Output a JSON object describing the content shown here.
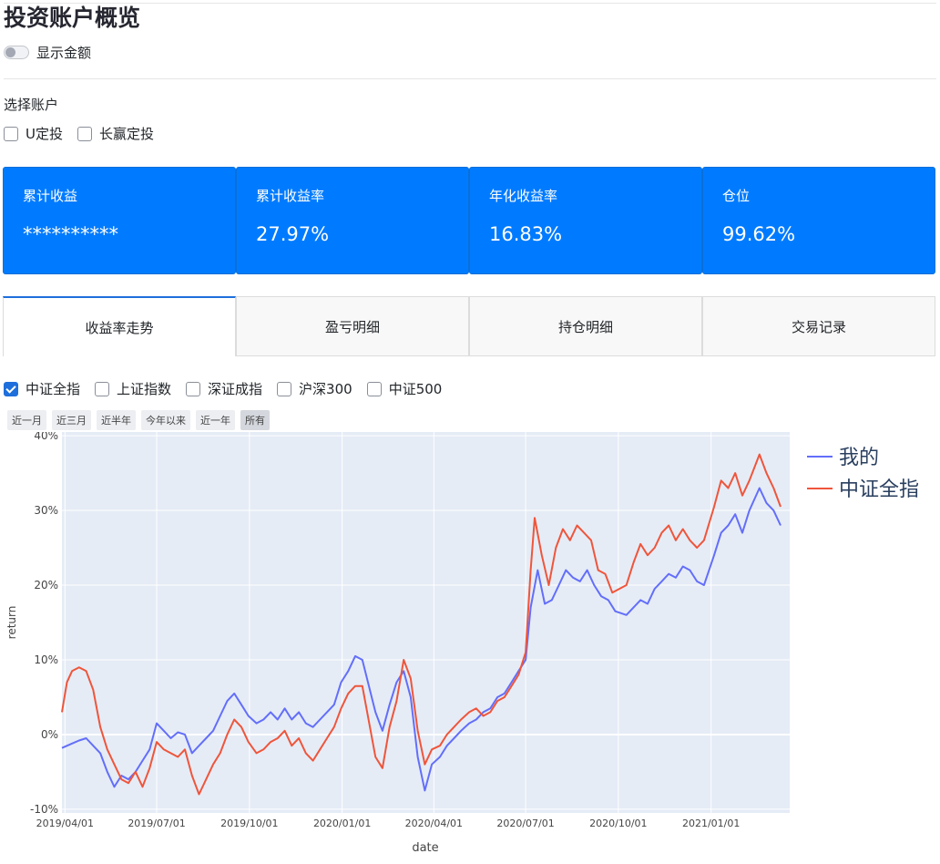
{
  "title": "投资账户概览",
  "show_amount_label": "显示金额",
  "select_account_label": "选择账户",
  "accounts": [
    {
      "label": "U定投",
      "checked": false
    },
    {
      "label": "长赢定投",
      "checked": false
    }
  ],
  "metrics": [
    {
      "label": "累计收益",
      "value": "**********"
    },
    {
      "label": "累计收益率",
      "value": "27.97%"
    },
    {
      "label": "年化收益率",
      "value": "16.83%"
    },
    {
      "label": "仓位",
      "value": "99.62%"
    }
  ],
  "tabs": [
    "收益率走势",
    "盈亏明细",
    "持仓明细",
    "交易记录"
  ],
  "active_tab": 0,
  "index_options": [
    {
      "label": "中证全指",
      "checked": true
    },
    {
      "label": "上证指数",
      "checked": false
    },
    {
      "label": "深证成指",
      "checked": false
    },
    {
      "label": "沪深300",
      "checked": false
    },
    {
      "label": "中证500",
      "checked": false
    }
  ],
  "range_buttons": [
    "近一月",
    "近三月",
    "近半年",
    "今年以来",
    "近一年",
    "所有"
  ],
  "active_range": 5,
  "colors": {
    "accent": "#007bff",
    "series_mine": "#636efa",
    "series_index": "#ef553b",
    "plot_bg": "#e5ecf6"
  },
  "chart_data": {
    "type": "line",
    "xlabel": "date",
    "ylabel": "return",
    "x_ticks": [
      "2019/04/01",
      "2019/07/01",
      "2019/10/01",
      "2020/01/01",
      "2020/04/01",
      "2020/07/01",
      "2020/10/01",
      "2021/01/01"
    ],
    "y_ticks": [
      "40%",
      "30%",
      "20%",
      "10%",
      "0%",
      "-10%"
    ],
    "xlim": [
      "2019-03-29",
      "2021-03-20"
    ],
    "ylim": [
      -10.5,
      40.5
    ],
    "grid": true,
    "legend": "top-right",
    "series": [
      {
        "name": "我的",
        "points": [
          [
            "2019-03-29",
            -1.8
          ],
          [
            "2019-04-08",
            -1.2
          ],
          [
            "2019-04-15",
            -0.8
          ],
          [
            "2019-04-22",
            -0.5
          ],
          [
            "2019-04-29",
            -1.5
          ],
          [
            "2019-05-06",
            -2.5
          ],
          [
            "2019-05-13",
            -5.0
          ],
          [
            "2019-05-20",
            -7.0
          ],
          [
            "2019-05-27",
            -5.5
          ],
          [
            "2019-06-03",
            -6.0
          ],
          [
            "2019-06-10",
            -5.0
          ],
          [
            "2019-06-17",
            -3.5
          ],
          [
            "2019-06-24",
            -2.0
          ],
          [
            "2019-07-01",
            1.5
          ],
          [
            "2019-07-08",
            0.5
          ],
          [
            "2019-07-15",
            -0.5
          ],
          [
            "2019-07-22",
            0.3
          ],
          [
            "2019-07-29",
            0.0
          ],
          [
            "2019-08-05",
            -2.5
          ],
          [
            "2019-08-12",
            -1.5
          ],
          [
            "2019-08-19",
            -0.5
          ],
          [
            "2019-08-26",
            0.5
          ],
          [
            "2019-09-02",
            2.5
          ],
          [
            "2019-09-09",
            4.5
          ],
          [
            "2019-09-16",
            5.5
          ],
          [
            "2019-09-23",
            4.0
          ],
          [
            "2019-09-30",
            2.5
          ],
          [
            "2019-10-08",
            1.5
          ],
          [
            "2019-10-15",
            2.0
          ],
          [
            "2019-10-22",
            3.0
          ],
          [
            "2019-10-29",
            2.0
          ],
          [
            "2019-11-05",
            3.5
          ],
          [
            "2019-11-12",
            2.0
          ],
          [
            "2019-11-19",
            3.0
          ],
          [
            "2019-11-26",
            1.5
          ],
          [
            "2019-12-03",
            1.0
          ],
          [
            "2019-12-10",
            2.0
          ],
          [
            "2019-12-17",
            3.0
          ],
          [
            "2019-12-24",
            4.0
          ],
          [
            "2019-12-31",
            7.0
          ],
          [
            "2020-01-07",
            8.5
          ],
          [
            "2020-01-14",
            10.5
          ],
          [
            "2020-01-21",
            10.0
          ],
          [
            "2020-02-03",
            3.0
          ],
          [
            "2020-02-10",
            0.5
          ],
          [
            "2020-02-17",
            4.0
          ],
          [
            "2020-02-24",
            7.0
          ],
          [
            "2020-03-02",
            8.5
          ],
          [
            "2020-03-09",
            5.0
          ],
          [
            "2020-03-16",
            -3.0
          ],
          [
            "2020-03-23",
            -7.5
          ],
          [
            "2020-03-30",
            -4.0
          ],
          [
            "2020-04-07",
            -3.0
          ],
          [
            "2020-04-14",
            -1.5
          ],
          [
            "2020-04-21",
            -0.5
          ],
          [
            "2020-04-28",
            0.5
          ],
          [
            "2020-05-06",
            1.5
          ],
          [
            "2020-05-13",
            2.0
          ],
          [
            "2020-05-20",
            3.0
          ],
          [
            "2020-05-27",
            3.5
          ],
          [
            "2020-06-03",
            5.0
          ],
          [
            "2020-06-10",
            5.5
          ],
          [
            "2020-06-17",
            7.0
          ],
          [
            "2020-06-24",
            8.5
          ],
          [
            "2020-07-01",
            10.0
          ],
          [
            "2020-07-06",
            17.0
          ],
          [
            "2020-07-13",
            22.0
          ],
          [
            "2020-07-20",
            17.5
          ],
          [
            "2020-07-27",
            18.0
          ],
          [
            "2020-08-03",
            20.0
          ],
          [
            "2020-08-10",
            22.0
          ],
          [
            "2020-08-17",
            21.0
          ],
          [
            "2020-08-24",
            20.5
          ],
          [
            "2020-08-31",
            22.0
          ],
          [
            "2020-09-07",
            20.0
          ],
          [
            "2020-09-14",
            18.5
          ],
          [
            "2020-09-21",
            18.0
          ],
          [
            "2020-09-28",
            16.5
          ],
          [
            "2020-10-09",
            16.0
          ],
          [
            "2020-10-16",
            17.0
          ],
          [
            "2020-10-23",
            18.0
          ],
          [
            "2020-10-30",
            17.5
          ],
          [
            "2020-11-06",
            19.5
          ],
          [
            "2020-11-13",
            20.5
          ],
          [
            "2020-11-20",
            21.5
          ],
          [
            "2020-11-27",
            21.0
          ],
          [
            "2020-12-04",
            22.5
          ],
          [
            "2020-12-11",
            22.0
          ],
          [
            "2020-12-18",
            20.5
          ],
          [
            "2020-12-25",
            20.0
          ],
          [
            "2021-01-04",
            24.0
          ],
          [
            "2021-01-11",
            27.0
          ],
          [
            "2021-01-18",
            28.0
          ],
          [
            "2021-01-25",
            29.5
          ],
          [
            "2021-02-01",
            27.0
          ],
          [
            "2021-02-08",
            30.0
          ],
          [
            "2021-02-18",
            33.0
          ],
          [
            "2021-02-25",
            31.0
          ],
          [
            "2021-03-04",
            30.0
          ],
          [
            "2021-03-11",
            28.0
          ]
        ]
      },
      {
        "name": "中证全指",
        "points": [
          [
            "2019-03-29",
            3.0
          ],
          [
            "2019-04-03",
            7.0
          ],
          [
            "2019-04-08",
            8.5
          ],
          [
            "2019-04-15",
            9.0
          ],
          [
            "2019-04-22",
            8.5
          ],
          [
            "2019-04-29",
            6.0
          ],
          [
            "2019-05-06",
            1.0
          ],
          [
            "2019-05-13",
            -2.0
          ],
          [
            "2019-05-20",
            -4.0
          ],
          [
            "2019-05-27",
            -6.0
          ],
          [
            "2019-06-03",
            -6.5
          ],
          [
            "2019-06-10",
            -5.0
          ],
          [
            "2019-06-17",
            -7.0
          ],
          [
            "2019-06-24",
            -4.5
          ],
          [
            "2019-07-01",
            -1.0
          ],
          [
            "2019-07-08",
            -2.0
          ],
          [
            "2019-07-15",
            -2.5
          ],
          [
            "2019-07-22",
            -3.0
          ],
          [
            "2019-07-29",
            -2.0
          ],
          [
            "2019-08-05",
            -5.5
          ],
          [
            "2019-08-12",
            -8.0
          ],
          [
            "2019-08-19",
            -6.0
          ],
          [
            "2019-08-26",
            -4.0
          ],
          [
            "2019-09-02",
            -2.5
          ],
          [
            "2019-09-09",
            0.0
          ],
          [
            "2019-09-16",
            2.0
          ],
          [
            "2019-09-23",
            1.0
          ],
          [
            "2019-09-30",
            -1.0
          ],
          [
            "2019-10-08",
            -2.5
          ],
          [
            "2019-10-15",
            -2.0
          ],
          [
            "2019-10-22",
            -1.0
          ],
          [
            "2019-10-29",
            -0.5
          ],
          [
            "2019-11-05",
            0.5
          ],
          [
            "2019-11-12",
            -1.5
          ],
          [
            "2019-11-19",
            -0.5
          ],
          [
            "2019-11-26",
            -2.5
          ],
          [
            "2019-12-03",
            -3.5
          ],
          [
            "2019-12-10",
            -2.0
          ],
          [
            "2019-12-17",
            -0.5
          ],
          [
            "2019-12-24",
            1.0
          ],
          [
            "2019-12-31",
            3.5
          ],
          [
            "2020-01-07",
            5.5
          ],
          [
            "2020-01-14",
            6.5
          ],
          [
            "2020-01-21",
            6.5
          ],
          [
            "2020-02-03",
            -3.0
          ],
          [
            "2020-02-10",
            -4.5
          ],
          [
            "2020-02-17",
            1.0
          ],
          [
            "2020-02-24",
            4.5
          ],
          [
            "2020-03-02",
            10.0
          ],
          [
            "2020-03-09",
            7.5
          ],
          [
            "2020-03-16",
            0.5
          ],
          [
            "2020-03-23",
            -4.0
          ],
          [
            "2020-03-30",
            -2.0
          ],
          [
            "2020-04-07",
            -1.5
          ],
          [
            "2020-04-14",
            0.0
          ],
          [
            "2020-04-21",
            1.0
          ],
          [
            "2020-04-28",
            2.0
          ],
          [
            "2020-05-06",
            3.0
          ],
          [
            "2020-05-13",
            3.5
          ],
          [
            "2020-05-20",
            2.5
          ],
          [
            "2020-05-27",
            3.0
          ],
          [
            "2020-06-03",
            4.5
          ],
          [
            "2020-06-10",
            5.0
          ],
          [
            "2020-06-17",
            6.5
          ],
          [
            "2020-06-24",
            8.0
          ],
          [
            "2020-07-01",
            11.0
          ],
          [
            "2020-07-06",
            22.0
          ],
          [
            "2020-07-10",
            29.0
          ],
          [
            "2020-07-17",
            24.0
          ],
          [
            "2020-07-24",
            20.0
          ],
          [
            "2020-07-31",
            25.0
          ],
          [
            "2020-08-07",
            27.5
          ],
          [
            "2020-08-14",
            26.0
          ],
          [
            "2020-08-21",
            28.0
          ],
          [
            "2020-08-28",
            27.0
          ],
          [
            "2020-09-04",
            26.0
          ],
          [
            "2020-09-11",
            22.0
          ],
          [
            "2020-09-18",
            21.5
          ],
          [
            "2020-09-25",
            19.0
          ],
          [
            "2020-10-09",
            20.0
          ],
          [
            "2020-10-16",
            23.0
          ],
          [
            "2020-10-23",
            25.5
          ],
          [
            "2020-10-30",
            24.0
          ],
          [
            "2020-11-06",
            25.0
          ],
          [
            "2020-11-13",
            27.0
          ],
          [
            "2020-11-20",
            28.0
          ],
          [
            "2020-11-27",
            26.0
          ],
          [
            "2020-12-04",
            27.5
          ],
          [
            "2020-12-11",
            26.0
          ],
          [
            "2020-12-18",
            25.0
          ],
          [
            "2020-12-25",
            26.0
          ],
          [
            "2021-01-04",
            30.5
          ],
          [
            "2021-01-11",
            34.0
          ],
          [
            "2021-01-18",
            33.0
          ],
          [
            "2021-01-25",
            35.0
          ],
          [
            "2021-02-01",
            32.0
          ],
          [
            "2021-02-08",
            34.0
          ],
          [
            "2021-02-18",
            37.5
          ],
          [
            "2021-02-25",
            35.0
          ],
          [
            "2021-03-04",
            33.0
          ],
          [
            "2021-03-11",
            30.5
          ]
        ]
      }
    ]
  }
}
